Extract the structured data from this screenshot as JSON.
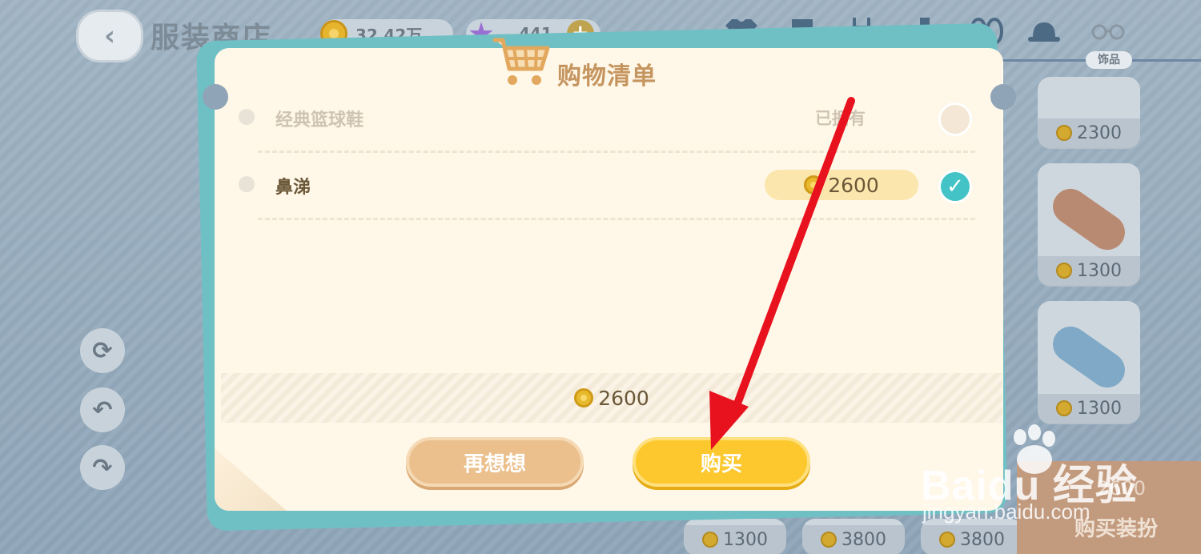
{
  "header": {
    "back_icon": "chevron-left-icon",
    "title": "服装商店",
    "coins": "32.42万",
    "stars": "441"
  },
  "categories": [
    {
      "icon": "shirt-icon"
    },
    {
      "icon": "pants-icon"
    },
    {
      "icon": "overalls-icon"
    },
    {
      "icon": "sock-icon"
    },
    {
      "icon": "sandals-icon"
    },
    {
      "icon": "hat-icon"
    },
    {
      "icon": "glasses-icon",
      "label": "饰品"
    }
  ],
  "side_items": [
    {
      "price": "2300"
    },
    {
      "price": "1300"
    },
    {
      "price": "1300"
    }
  ],
  "bottom_prices": [
    "1300",
    "3800",
    "3800"
  ],
  "buy_outfit": {
    "amount": "2600",
    "label": "购买装扮"
  },
  "modal": {
    "title": "购物清单",
    "items": [
      {
        "name": "经典篮球鞋",
        "status": "已拥有",
        "selected": false
      },
      {
        "name": "鼻涕",
        "price": "2600",
        "selected": true
      }
    ],
    "total": "2600",
    "cancel_label": "再想想",
    "buy_label": "购买"
  },
  "watermark": {
    "brand": "Baidu 经验",
    "site": "jingyan.baidu.com"
  },
  "colors": {
    "modal_bg": "#fff7e8",
    "modal_frame": "#6fc0c4",
    "buy_button": "#fcc82d",
    "cancel_button": "#ebc08d",
    "check_selected": "#43c3c6",
    "annotation_arrow": "#e8121f"
  }
}
